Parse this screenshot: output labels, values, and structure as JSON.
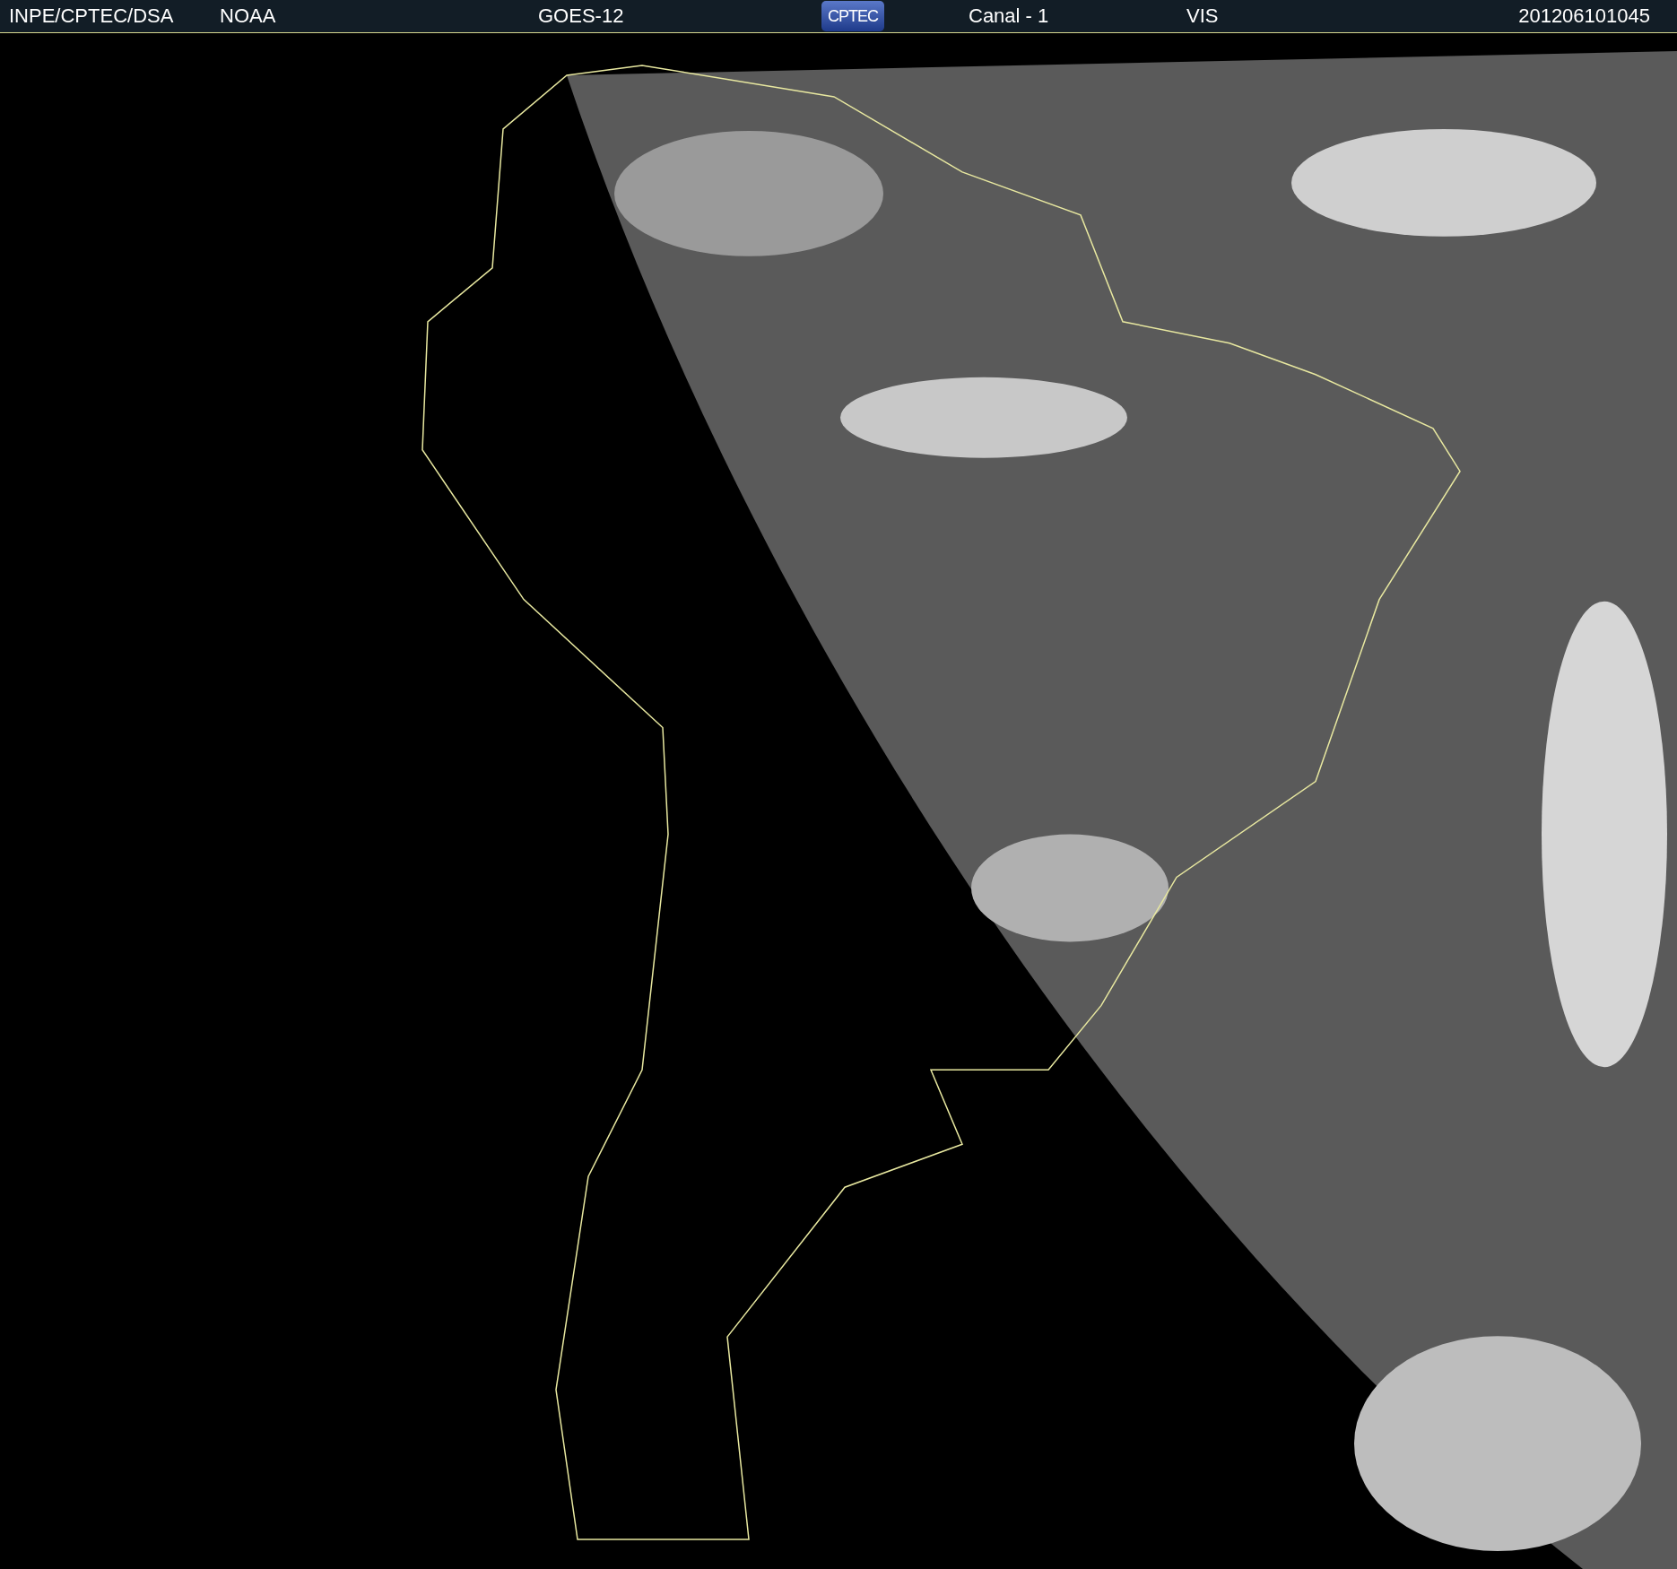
{
  "header": {
    "labels": [
      "INPE/CPTEC/DSA",
      "NOAA",
      "GOES-12"
    ],
    "logo": {
      "text": "CPTEC"
    },
    "labels_after_logo": [
      "Canal - 1",
      "VIS",
      "201206101045"
    ]
  }
}
